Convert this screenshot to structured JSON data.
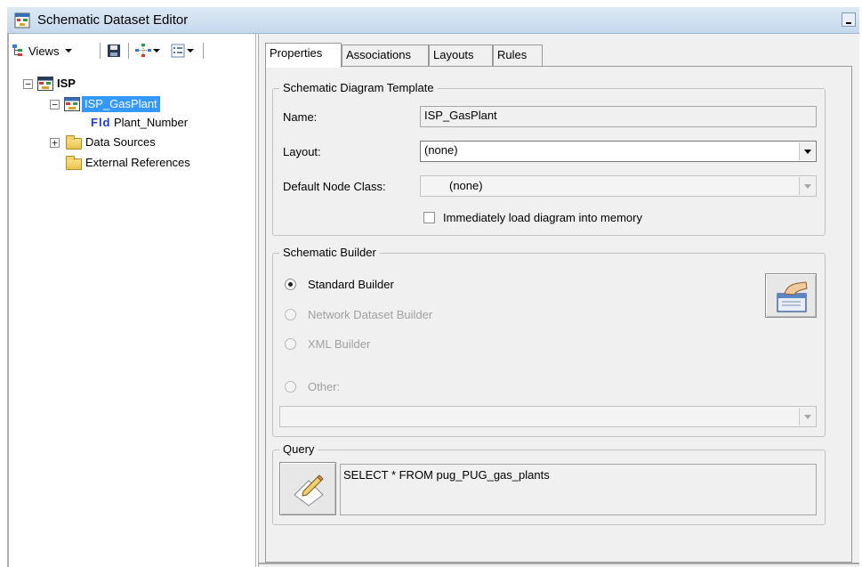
{
  "window": {
    "title": "Schematic Dataset Editor"
  },
  "toolbar": {
    "views_label": "Views"
  },
  "tree": {
    "root": "ISP",
    "template": "ISP_GasPlant",
    "field_badge": "Fld",
    "field": "Plant_Number",
    "data_sources": "Data Sources",
    "external_references": "External References"
  },
  "tabs": [
    "Properties",
    "Associations",
    "Layouts",
    "Rules"
  ],
  "template_group": {
    "legend": "Schematic Diagram Template",
    "name_label": "Name:",
    "name_value": "ISP_GasPlant",
    "layout_label": "Layout:",
    "layout_value": "(none)",
    "node_class_label": "Default Node Class:",
    "node_class_value": "(none)",
    "load_memory_label": "Immediately load diagram into memory"
  },
  "builder_group": {
    "legend": "Schematic Builder",
    "options": [
      {
        "label": "Standard Builder",
        "checked": true,
        "enabled": true
      },
      {
        "label": "Network Dataset Builder",
        "checked": false,
        "enabled": false
      },
      {
        "label": "XML Builder",
        "checked": false,
        "enabled": false
      },
      {
        "label": "Other:",
        "checked": false,
        "enabled": false
      }
    ],
    "other_value": ""
  },
  "query_group": {
    "legend": "Query",
    "query_text": "SELECT * FROM pug_PUG_gas_plants"
  },
  "colors": {
    "selection": "#3399ff",
    "titlebar": "#cfdff0",
    "panel": "#f0f0f0"
  }
}
